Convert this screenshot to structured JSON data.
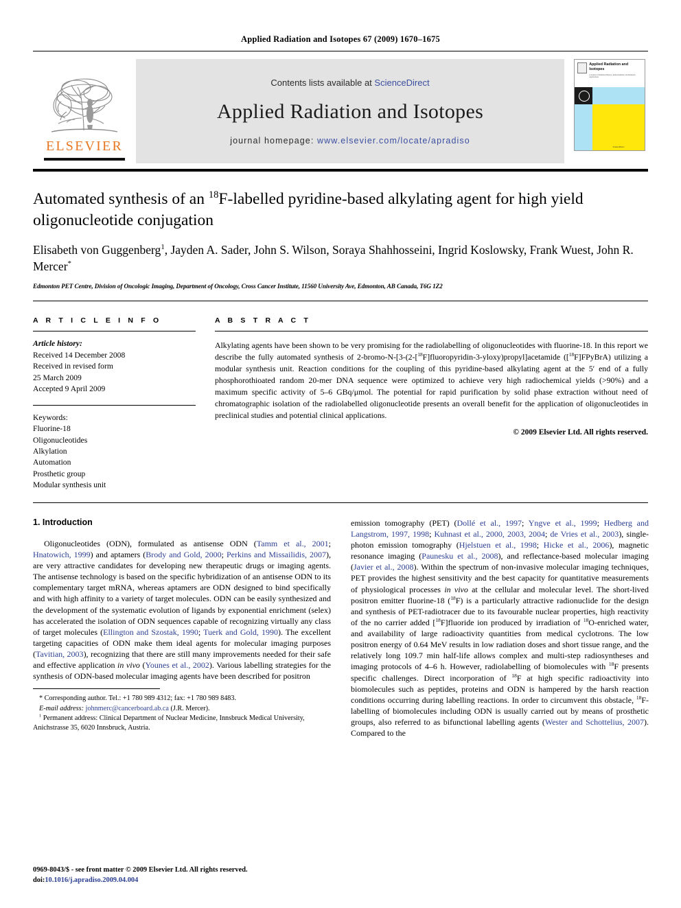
{
  "running_head": "Applied Radiation and Isotopes 67 (2009) 1670–1675",
  "masthead": {
    "contents_prefix": "Contents lists available at ",
    "sciencedirect": "ScienceDirect",
    "journal_name": "Applied Radiation and Isotopes",
    "homepage_label": "journal homepage: ",
    "homepage_url": "www.elsevier.com/locate/apradiso",
    "publisher_wordmark": "ELSEVIER",
    "cover": {
      "title": "Applied Radiation and Isotopes",
      "subtitle": "A Journal of Radiation Physics, Radiochemistry and Radiation Applications"
    }
  },
  "article": {
    "title_part1": "Automated synthesis of an ",
    "title_sup": "18",
    "title_part2": "F-labelled pyridine-based alkylating agent for high yield oligonucleotide conjugation",
    "authors": "Elisabeth von Guggenberg , Jayden A. Sader, John S. Wilson, Soraya Shahhosseini, Ingrid Koslowsky, Frank Wuest, John R. Mercer",
    "author_marker_1": "1",
    "author_marker_star": "*",
    "affiliation": "Edmonton PET Centre, Division of Oncologic Imaging, Department of Oncology, Cross Cancer Institute, 11560 University Ave, Edmonton, AB Canada, T6G 1Z2"
  },
  "article_info": {
    "heading": "A R T I C L E   I N F O",
    "history_label": "Article history:",
    "history": [
      "Received 14 December 2008",
      "Received in revised form",
      "25 March 2009",
      "Accepted 9 April 2009"
    ],
    "keywords_label": "Keywords:",
    "keywords": [
      "Fluorine-18",
      "Oligonucleotides",
      "Alkylation",
      "Automation",
      "Prosthetic group",
      "Modular synthesis unit"
    ]
  },
  "abstract": {
    "heading": "A B S T R A C T",
    "text": "Alkylating agents have been shown to be very promising for the radiolabelling of oligonucleotides with fluorine-18. In this report we describe the fully automated synthesis of 2-bromo-N-[3-(2-[18F]fluoropyridin-3-yloxy)propyl]acetamide ([18F]FPyBrA) utilizing a modular synthesis unit. Reaction conditions for the coupling of this pyridine-based alkylating agent at the 5′ end of a fully phosphorothioated random 20-mer DNA sequence were optimized to achieve very high radiochemical yields (>90%) and a maximum specific activity of 5–6 GBq/μmol. The potential for rapid purification by solid phase extraction without need of chromatographic isolation of the radiolabelled oligonucleotide presents an overall benefit for the application of oligonucleotides in preclinical studies and potential clinical applications.",
    "copyright": "© 2009 Elsevier Ltd. All rights reserved."
  },
  "body": {
    "section_heading": "1. Introduction",
    "left_paragraph": "Oligonucleotides (ODN), formulated as antisense ODN (Tamm et al., 2001; Hnatowich, 1999) and aptamers (Brody and Gold, 2000; Perkins and Missailidis, 2007), are very attractive candidates for developing new therapeutic drugs or imaging agents. The antisense technology is based on the specific hybridization of an antisense ODN to its complementary target mRNA, whereas aptamers are ODN designed to bind specifically and with high affinity to a variety of target molecules. ODN can be easily synthesized and the development of the systematic evolution of ligands by exponential enrichment (selex) has accelerated the isolation of ODN sequences capable of recognizing virtually any class of target molecules (Ellington and Szostak, 1990; Tuerk and Gold, 1990). The excellent targeting capacities of ODN make them ideal agents for molecular imaging purposes (Tavitian, 2003), recognizing that there are still many improvements needed for their safe and effective application in vivo (Younes et al., 2002). Various labelling strategies for the synthesis of ODN-based molecular imaging agents have been described for positron",
    "right_paragraph": "emission tomography (PET) (Dollé et al., 1997; Yngve et al., 1999; Hedberg and Langstrom, 1997, 1998; Kuhnast et al., 2000, 2003, 2004; de Vries et al., 2003), single-photon emission tomography (Hjelstuen et al., 1998; Hicke et al., 2006), magnetic resonance imaging (Paunesku et al., 2008), and reflectance-based molecular imaging (Javier et al., 2008). Within the spectrum of non-invasive molecular imaging techniques, PET provides the highest sensitivity and the best capacity for quantitative measurements of physiological processes in vivo at the cellular and molecular level. The short-lived positron emitter fluorine-18 (18F) is a particularly attractive radionuclide for the design and synthesis of PET-radiotracer due to its favourable nuclear properties, high reactivity of the no carrier added [18F]fluoride ion produced by irradiation of 18O-enriched water, and availability of large radioactivity quantities from medical cyclotrons. The low positron energy of 0.64 MeV results in low radiation doses and short tissue range, and the relatively long 109.7 min half-life allows complex and multi-step radiosyntheses and imaging protocols of 4–6 h. However, radiolabelling of biomolecules with 18F presents specific challenges. Direct incorporation of 18F at high specific radioactivity into biomolecules such as peptides, proteins and ODN is hampered by the harsh reaction conditions occurring during labelling reactions. In order to circumvent this obstacle, 18F-labelling of biomolecules including ODN is usually carried out by means of prosthetic groups, also referred to as bifunctional labelling agents (Wester and Schottelius, 2007). Compared to the"
  },
  "footnotes": {
    "corresponding": "* Corresponding author. Tel.: +1 780 989 4312; fax: +1 780 989 8483.",
    "email_label": "E-mail address:",
    "email": "johnmerc@cancerboard.ab.ca",
    "email_suffix": "(J.R. Mercer).",
    "permanent_marker": "1",
    "permanent": "Permanent address: Clinical Department of Nuclear Medicine, Innsbruck Medical University, Anichstrasse 35, 6020 Innsbruck, Austria."
  },
  "imprint": {
    "issn_line": "0969-8043/$ - see front matter © 2009 Elsevier Ltd. All rights reserved.",
    "doi_label": "doi:",
    "doi": "10.1016/j.apradiso.2009.04.004"
  },
  "colors": {
    "link_blue": "#3b4ea0",
    "citation_blue": "#2b3f93",
    "elsevier_orange": "#e87722",
    "masthead_gray": "#e3e3e3"
  }
}
